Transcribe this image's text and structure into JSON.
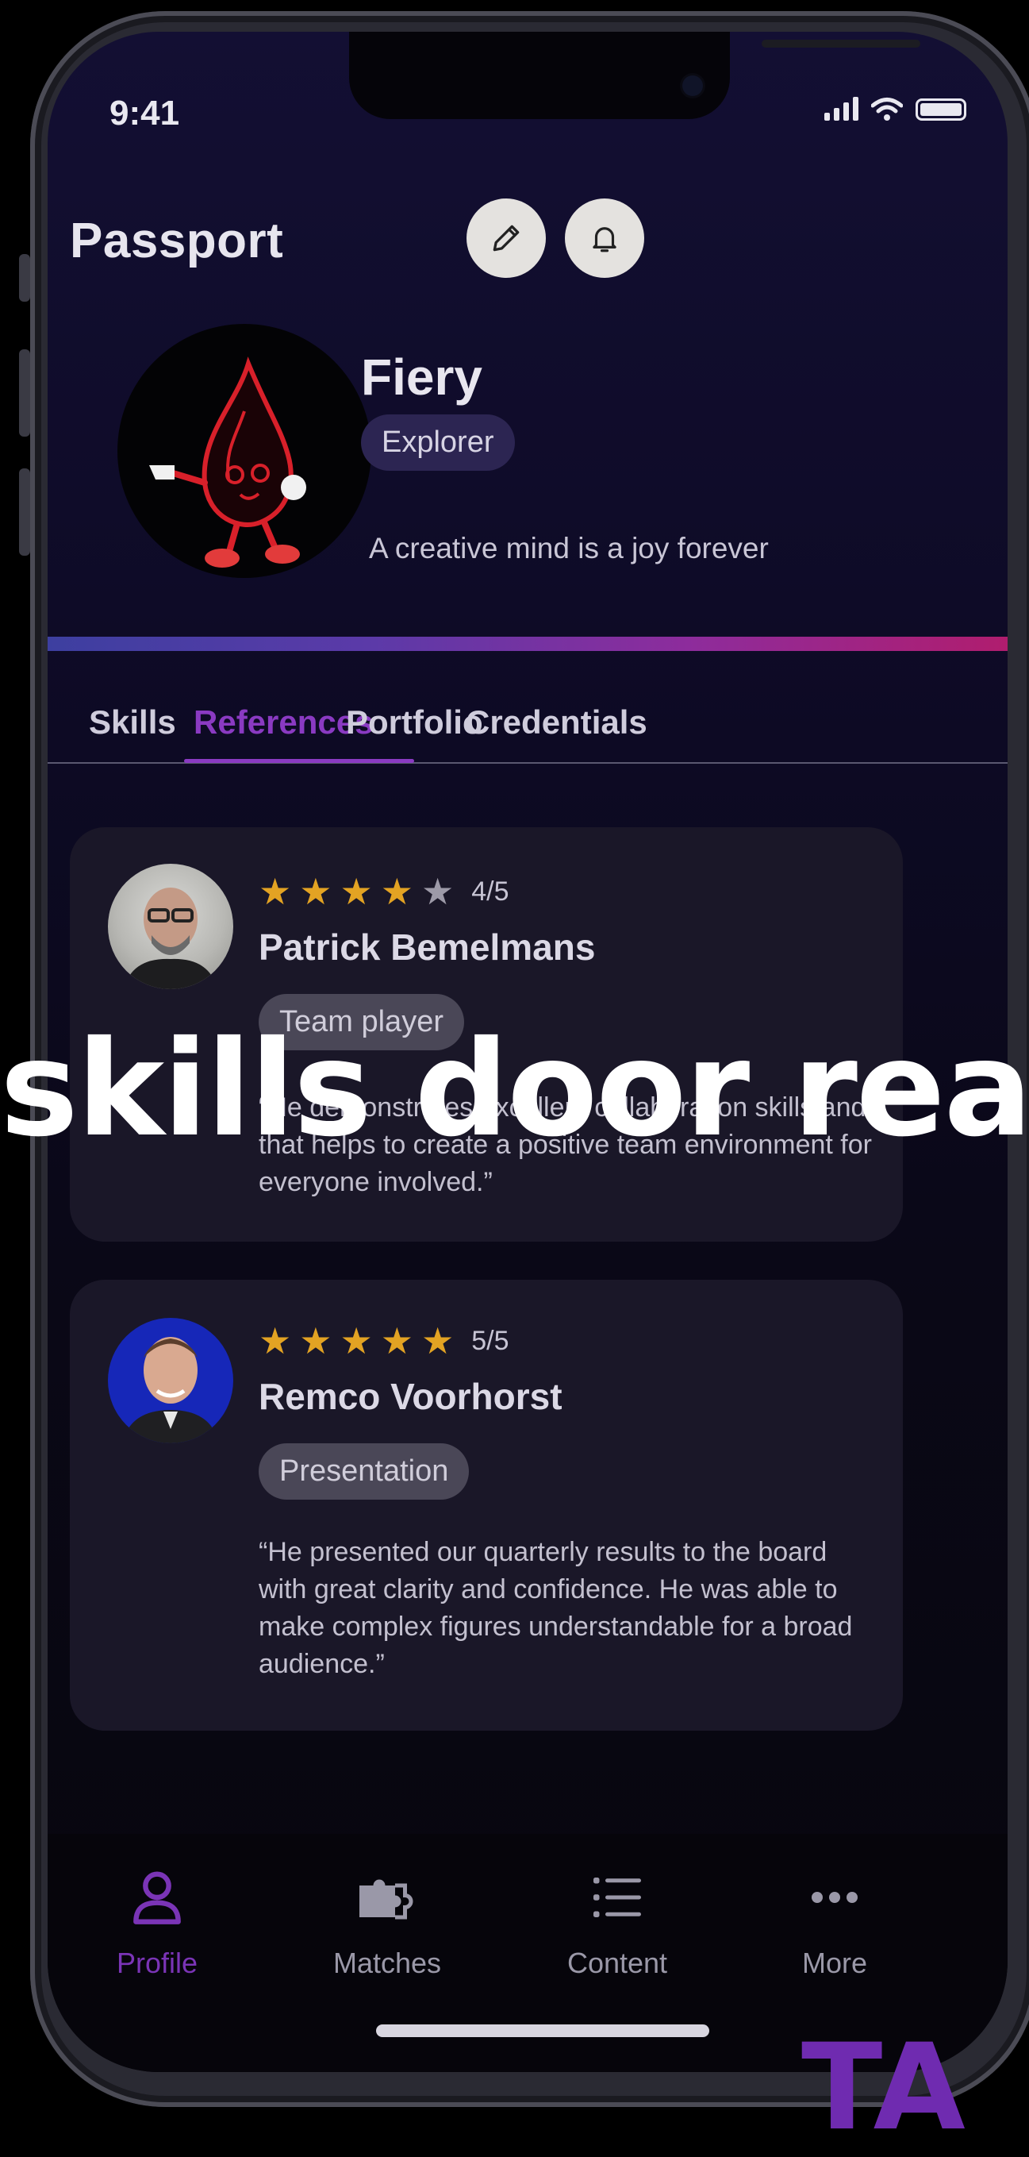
{
  "status_bar": {
    "time": "9:41"
  },
  "header": {
    "title": "Passport"
  },
  "profile": {
    "name": "Fiery",
    "level": "Explorer",
    "motto": "A creative mind is a joy forever"
  },
  "tabs": [
    {
      "label": "Skills",
      "active": false
    },
    {
      "label": "References",
      "active": true
    },
    {
      "label": "Portfolio",
      "active": false
    },
    {
      "label": "Credentials",
      "active": false
    }
  ],
  "references": [
    {
      "name": "Patrick Bemelmans",
      "rating": "4/5",
      "stars": 4,
      "skill": "Team player",
      "quote": "“He demonstrates excellent collaboration skills and that helps to create a positive team environment for everyone involved.”"
    },
    {
      "name": "Remco Voorhorst",
      "rating": "5/5",
      "stars": 5,
      "skill": "Presentation",
      "quote": "“He presented our quarterly results to the board with great clarity and confidence. He was able to make complex figures understandable for a broad audience.”"
    }
  ],
  "bottom_nav": [
    {
      "label": "Profile",
      "icon": "person-icon",
      "active": true
    },
    {
      "label": "Matches",
      "icon": "puzzle-icon",
      "active": false
    },
    {
      "label": "Content",
      "icon": "list-icon",
      "active": false
    },
    {
      "label": "More",
      "icon": "more-dots-icon",
      "active": false
    }
  ],
  "overlay": {
    "caption": "skills door rea"
  },
  "watermark": {
    "text": "TA"
  },
  "colors": {
    "accent": "#8a3ac2",
    "star_filled": "#e3a323",
    "star_empty": "#9d9aa8",
    "background": "#0d0a24"
  }
}
